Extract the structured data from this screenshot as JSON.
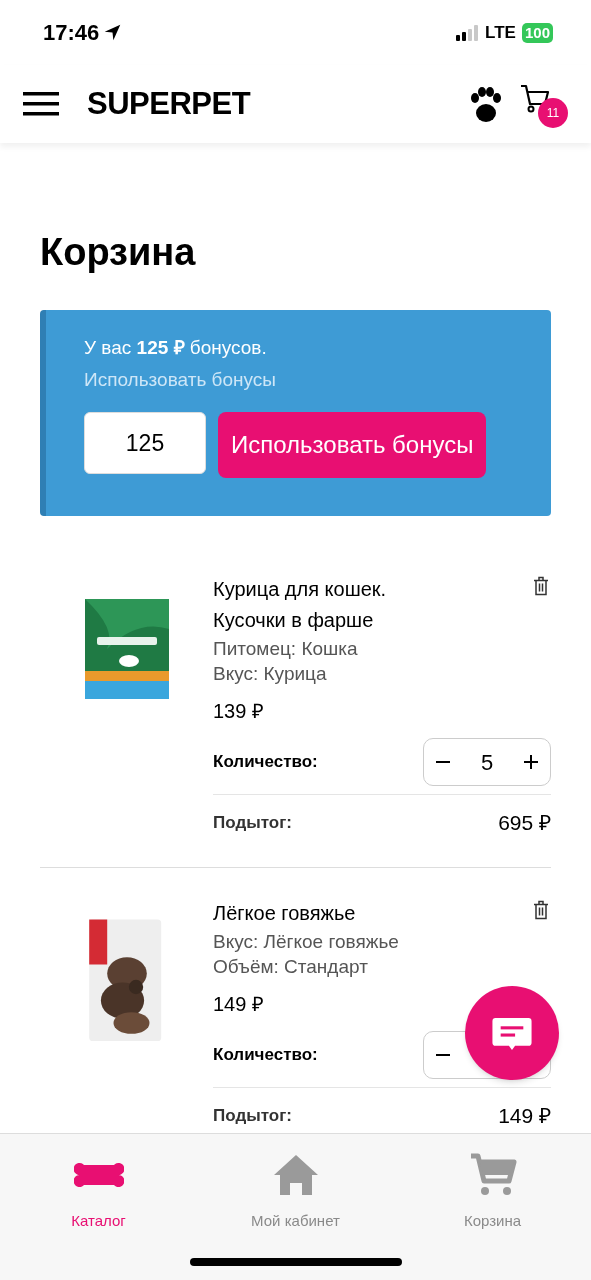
{
  "status_bar": {
    "time": "17:46",
    "network": "LTE",
    "battery": "100"
  },
  "header": {
    "logo": "SUPERPET",
    "cart_count": "11"
  },
  "title": "Корзина",
  "bonus": {
    "text": "У вас **125 ₽** бонусов.",
    "link": "Использовать бонусы",
    "value": "125",
    "button": "Использовать бонусы"
  },
  "items": [
    {
      "title": "Курица для кошек. Кусочки в фарше",
      "attributes": [
        "Питомец: Кошка",
        "Вкус: Курица"
      ],
      "price": "139 ₽",
      "quantity_label": "Количество:",
      "quantity": "5",
      "subtotal_label": "Подытог:",
      "subtotal": "695 ₽"
    },
    {
      "title": "Лёгкое говяжье",
      "attributes": [
        "Вкус: Лёгкое говяжье",
        "Объём: Стандарт"
      ],
      "price": "149 ₽",
      "quantity_label": "Количество:",
      "subtotal_label": "Подытог:",
      "subtotal": "149 ₽"
    }
  ],
  "nav": [
    {
      "label": "Каталог",
      "selected": true
    },
    {
      "label": "Мой кабинет",
      "selected": false
    },
    {
      "label": "Корзина",
      "selected": false
    }
  ]
}
